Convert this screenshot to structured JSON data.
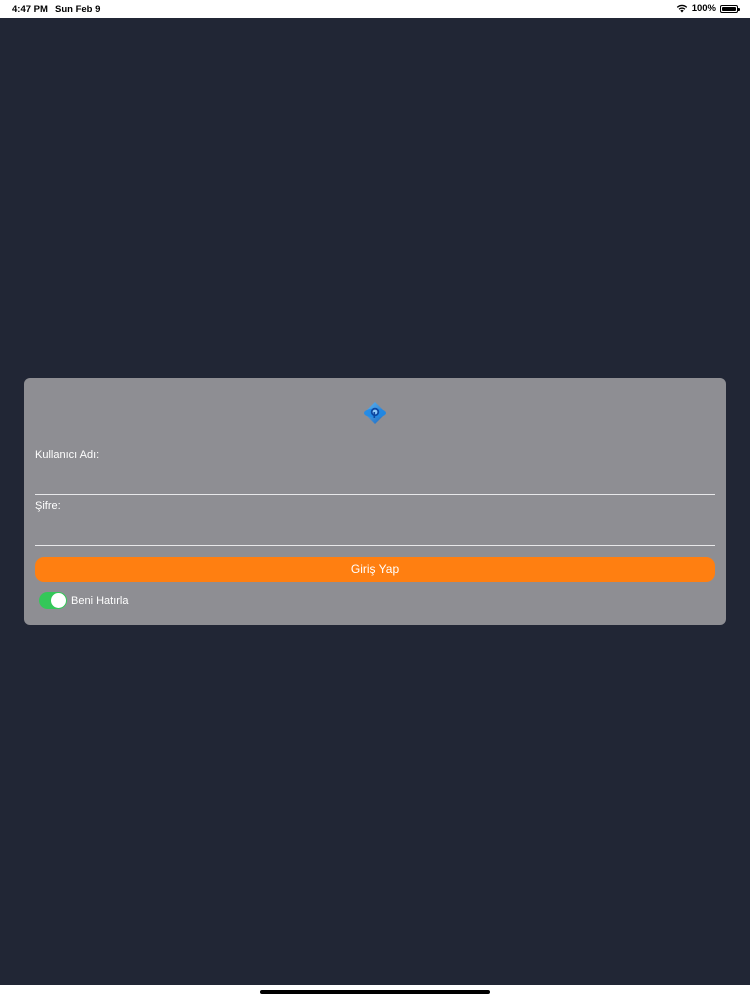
{
  "status_bar": {
    "time": "4:47 PM",
    "date": "Sun Feb 9",
    "battery": "100%"
  },
  "login": {
    "logo_icon": "app-logo-icon",
    "username_label": "Kullanıcı Adı:",
    "username_value": "",
    "password_label": "Şifre:",
    "password_value": "",
    "submit_label": "Giriş Yap",
    "remember_label": "Beni Hatırla",
    "remember_enabled": true
  },
  "colors": {
    "background": "#212635",
    "card": "#8e8e93",
    "button": "#ff7f11",
    "toggle_on": "#34c759"
  }
}
